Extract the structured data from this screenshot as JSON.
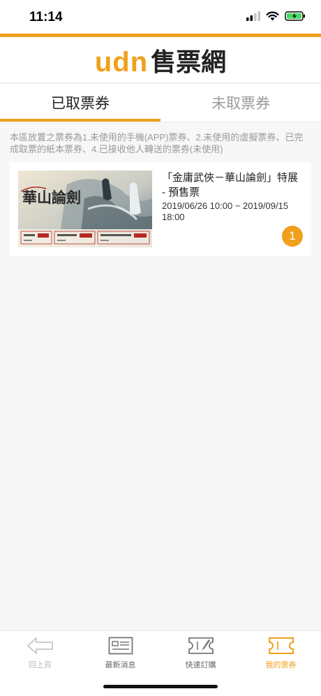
{
  "status": {
    "time": "11:14"
  },
  "header": {
    "logo_latin": "udn",
    "logo_cn": "售票網"
  },
  "tabs": [
    {
      "label": "已取票券",
      "active": true
    },
    {
      "label": "未取票券",
      "active": false
    }
  ],
  "notice": "本區放置之票券為1.未使用的手機(APP)票券、2.未使用的虛擬票券、已完成取票的紙本票券、4.已接收他人轉送的票券(未使用)",
  "ticket": {
    "title": "「金庸武俠－華山論劍」特展 - 預售票",
    "date": "2019/06/26 10:00 ~ 2019/09/15 18:00",
    "count": "1",
    "poster_text": "華山論劍"
  },
  "nav": [
    {
      "label": "回上頁",
      "icon": "back-arrow-icon"
    },
    {
      "label": "最新消息",
      "icon": "news-icon"
    },
    {
      "label": "快速訂購",
      "icon": "quick-order-icon"
    },
    {
      "label": "我的票券",
      "icon": "ticket-icon"
    }
  ],
  "colors": {
    "accent": "#f0a01c"
  }
}
